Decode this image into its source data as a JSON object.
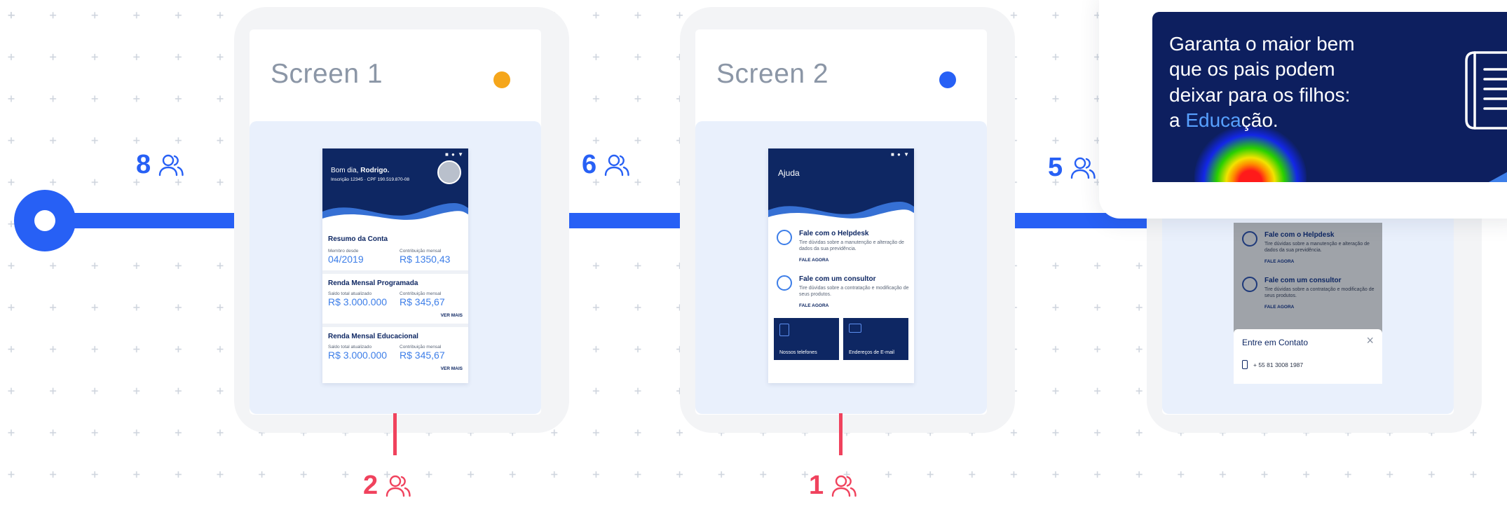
{
  "colors": {
    "flow": "#2760f5",
    "drop": "#f0425d",
    "dot_orange": "#f5a61b",
    "dot_blue": "#2760f5",
    "navy": "#0e2763"
  },
  "flow": {
    "counts": [
      {
        "value": "8",
        "icon": "users-icon"
      },
      {
        "value": "6",
        "icon": "users-icon"
      },
      {
        "value": "5",
        "icon": "users-icon"
      }
    ],
    "drops": [
      {
        "value": "2",
        "icon": "users-icon"
      },
      {
        "value": "1",
        "icon": "users-icon"
      }
    ]
  },
  "screens": [
    {
      "title": "Screen 1",
      "dot_color": "#f5a61b",
      "phone": {
        "status": "■ ● ▼",
        "greeting_prefix": "Bom dia, ",
        "greeting_name": "Rodrigo.",
        "subline": "Inscrição 12345 · CPF 190.519.870-08",
        "sections": [
          {
            "title": "Resumo da Conta",
            "l1": "Membro desde",
            "v1": "04/2019",
            "l2": "Contribuição mensal",
            "v2": "R$ 1350,43",
            "more": ""
          },
          {
            "title": "Renda Mensal Programada",
            "l1": "Saldo total atualizado",
            "v1": "R$ 3.000.000",
            "l2": "Contribuição mensal",
            "v2": "R$ 345,67",
            "more": "VER MAIS"
          },
          {
            "title": "Renda Mensal Educacional",
            "l1": "Saldo total atualizado",
            "v1": "R$ 3.000.000",
            "l2": "Contribuição mensal",
            "v2": "R$ 345,67",
            "more": "VER MAIS"
          }
        ]
      }
    },
    {
      "title": "Screen 2",
      "dot_color": "#2760f5",
      "phone": {
        "status": "■ ● ▼",
        "header": "Ajuda",
        "items": [
          {
            "title": "Fale com o Helpdesk",
            "desc": "Tire dúvidas sobre a manutenção e alteração de dados da sua previdência.",
            "cta": "FALE AGORA",
            "icon": "headset-icon"
          },
          {
            "title": "Fale com um consultor",
            "desc": "Tire dúvidas sobre a contratação e modificação de seus produtos.",
            "cta": "FALE AGORA",
            "icon": "person-icon"
          }
        ],
        "tiles": [
          {
            "label": "Nossos telefones",
            "icon": "phone-icon"
          },
          {
            "label": "Endereços de E-mail",
            "icon": "mail-icon"
          }
        ]
      }
    },
    {
      "phone": {
        "items": [
          {
            "title": "Fale com o Helpdesk",
            "desc": "Tire dúvidas sobre a manutenção e alteração de dados da sua previdência.",
            "cta": "FALE AGORA"
          },
          {
            "title": "Fale com um consultor",
            "desc": "Tire dúvidas sobre a contratação e modificação de seus produtos.",
            "cta": "FALE AGORA"
          }
        ],
        "sheet_title": "Entre em Contato",
        "sheet_phone": "+ 55 81 3008 1987"
      }
    }
  ],
  "banner": {
    "line1": "Garanta o maior bem",
    "line2": "que os pais podem",
    "line3": "deixar para os filhos:",
    "line4_prefix": "a ",
    "line4_highlight": "Educa",
    "line4_suffix": "ção.",
    "icon": "book-icon"
  }
}
